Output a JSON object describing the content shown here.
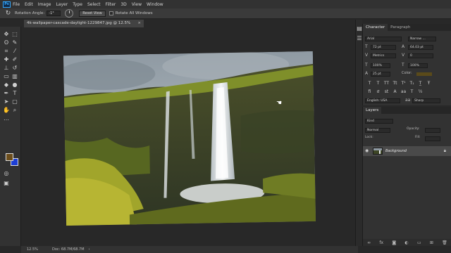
{
  "menubar": {
    "logo": "Ps",
    "items": [
      "File",
      "Edit",
      "Image",
      "Layer",
      "Type",
      "Select",
      "Filter",
      "3D",
      "View",
      "Window"
    ]
  },
  "options": {
    "tool_icon": "rotate-view-icon",
    "rotation_label": "Rotation Angle:",
    "rotation_value": "-1°",
    "reset_view": "Reset View",
    "rotate_all": "Rotate All Windows"
  },
  "document": {
    "tab_title": "4k-wallpaper-cascade-daylight-1229847.jpg @ 12.5% (RGB/8) *",
    "close_glyph": "×"
  },
  "colors": {
    "foreground": "#6b4d1c",
    "background": "#1d3fd4",
    "text_color": "#5a4a1a"
  },
  "status": {
    "zoom": "12.5%",
    "doc": "Doc: 68.7M/68.7M",
    "arrow": "›"
  },
  "character_panel": {
    "tabs": [
      "Character",
      "Paragraph"
    ],
    "font_family": "Arial",
    "font_style": "Narrow ...",
    "font_size": "72 pt",
    "leading": "64.03 pt",
    "kerning": "Metrics",
    "tracking": "0",
    "vscale": "100%",
    "hscale": "100%",
    "baseline": "25 pt",
    "color_label": "Color:",
    "language": "English: USA",
    "antialias": "Sharp"
  },
  "layers_panel": {
    "tabs": [
      "Layers"
    ],
    "kind_label": "Kind",
    "blend_mode": "Normal",
    "opacity_label": "Opacity:",
    "lock_label": "Lock:",
    "fill_label": "Fill:",
    "layer_name": "Background"
  }
}
